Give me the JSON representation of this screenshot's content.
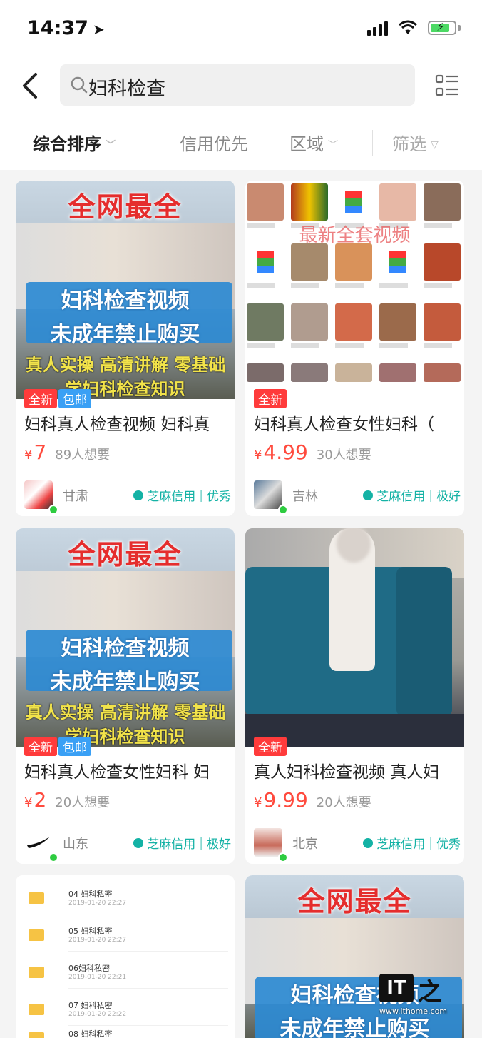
{
  "status": {
    "time": "14:37"
  },
  "search": {
    "query": "妇科检查"
  },
  "sort": {
    "items": [
      "综合排序",
      "信用优先",
      "区域",
      "筛选"
    ]
  },
  "colors": {
    "price": "#ff4a3d",
    "credit": "#14b2a5",
    "tag_new": "#ff3b3b",
    "tag_ship": "#3aa0f5"
  },
  "thumb_text": {
    "a_line1": "全网最全",
    "a_line2": "妇科检查视频",
    "a_line3": "未成年禁止购买",
    "a_line4": "真人实操 高清讲解 零基础",
    "a_line5": "学妇科检查知识",
    "b_watermark": "最新全套视频"
  },
  "folder_list": [
    {
      "name": "04 妇科私密",
      "date": "2019-01-20 22:27"
    },
    {
      "name": "05 妇科私密",
      "date": "2019-01-20 22:27"
    },
    {
      "name": "06妇科私密",
      "date": "2019-01-20 22:21"
    },
    {
      "name": "07 妇科私密",
      "date": "2019-01-20 22:22"
    },
    {
      "name": "08 妇科私密",
      "date": ""
    }
  ],
  "products": [
    {
      "title": "妇科真人检查视频 妇科真",
      "tags": [
        "全新",
        "包邮"
      ],
      "currency": "¥",
      "price": "7",
      "wants": "89人想要",
      "region": "甘肃",
      "credit": "芝麻信用",
      "credit_level": "优秀"
    },
    {
      "title": "妇科真人检查女性妇科（",
      "tags": [
        "全新"
      ],
      "currency": "¥",
      "price": "4.99",
      "wants": "30人想要",
      "region": "吉林",
      "credit": "芝麻信用",
      "credit_level": "极好"
    },
    {
      "title": "妇科真人检查女性妇科 妇",
      "tags": [
        "全新",
        "包邮"
      ],
      "currency": "¥",
      "price": "2",
      "wants": "20人想要",
      "region": "山东",
      "credit": "芝麻信用",
      "credit_level": "极好"
    },
    {
      "title": "真人妇科检查视频 真人妇",
      "tags": [
        "全新"
      ],
      "currency": "¥",
      "price": "9.99",
      "wants": "20人想要",
      "region": "北京",
      "credit": "芝麻信用",
      "credit_level": "优秀"
    }
  ],
  "watermark": {
    "logo": "IT",
    "char": "之",
    "url": "www.ithome.com"
  }
}
